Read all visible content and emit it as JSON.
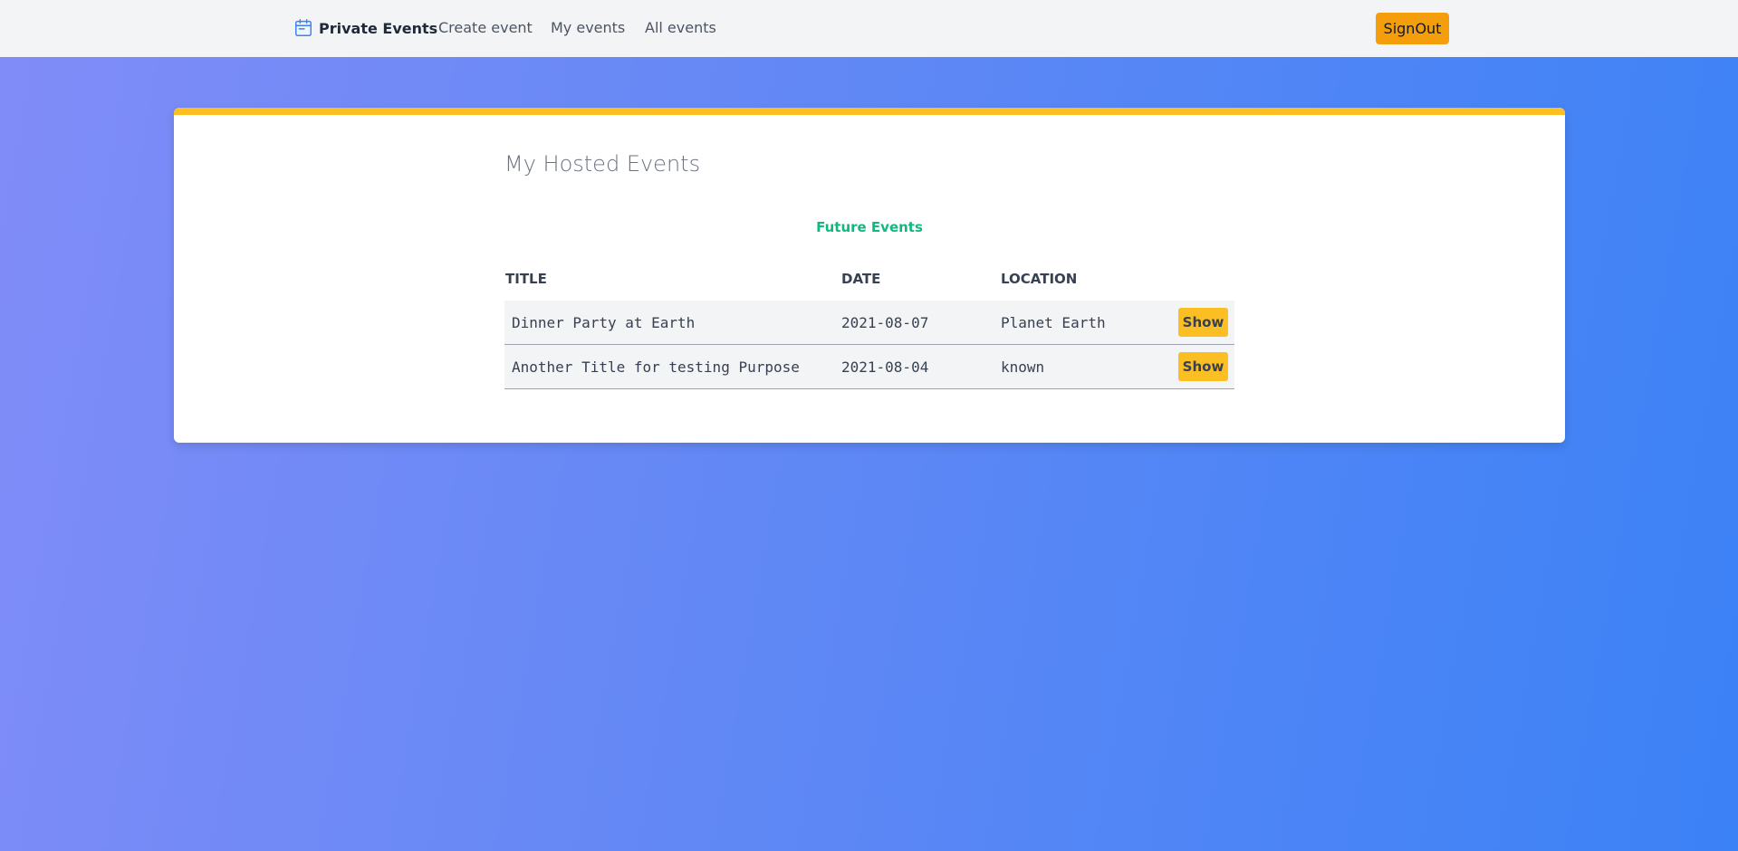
{
  "navbar": {
    "brand_label": "Private Events",
    "brand_icon": "calendar-icon",
    "links": [
      {
        "label": "Create event"
      },
      {
        "label": "My events"
      },
      {
        "label": "All events"
      }
    ],
    "signout_label": "SignOut"
  },
  "main": {
    "title": "My Hosted Events",
    "section_title": "Future Events",
    "table": {
      "headers": [
        "TITLE",
        "DATE",
        "LOCATION"
      ],
      "rows": [
        {
          "title": "Dinner Party at Earth",
          "date": "2021-08-07",
          "location": "Planet Earth",
          "action": "Show"
        },
        {
          "title": "Another Title for testing Purpose",
          "date": "2021-08-04",
          "location": "known",
          "action": "Show"
        }
      ]
    }
  },
  "colors": {
    "accent_yellow": "#fbbf24",
    "signout_orange": "#f59e0b",
    "section_green": "#10b981",
    "gradient_start": "#818cf8",
    "gradient_end": "#3b82f6"
  }
}
